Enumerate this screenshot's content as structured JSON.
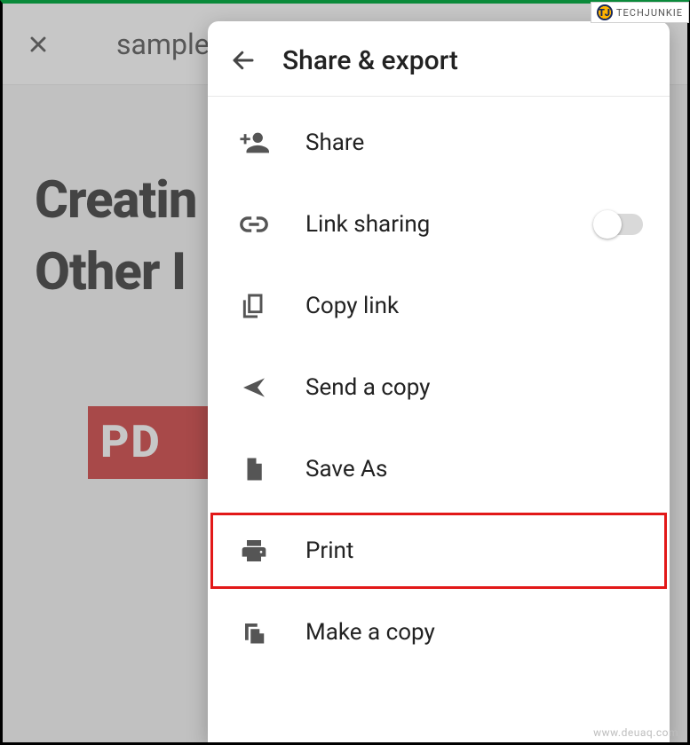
{
  "topbar": {
    "filename": "sample"
  },
  "page": {
    "heading_line1": "Creatin",
    "heading_line2": "Other I",
    "badge_text": "PD"
  },
  "sheet": {
    "title": "Share & export",
    "items": [
      {
        "label": "Share",
        "icon": "person-add-icon",
        "toggle": false
      },
      {
        "label": "Link sharing",
        "icon": "link-icon",
        "toggle": true,
        "toggle_on": false
      },
      {
        "label": "Copy link",
        "icon": "copy-icon",
        "toggle": false
      },
      {
        "label": "Send a copy",
        "icon": "send-icon",
        "toggle": false
      },
      {
        "label": "Save As",
        "icon": "file-icon",
        "toggle": false
      },
      {
        "label": "Print",
        "icon": "print-icon",
        "toggle": false,
        "highlight": true
      },
      {
        "label": "Make a copy",
        "icon": "duplicate-icon",
        "toggle": false
      }
    ]
  },
  "watermarks": {
    "top_right": "TECHJUNKIE",
    "bottom_right": "www.deuaq.com"
  }
}
